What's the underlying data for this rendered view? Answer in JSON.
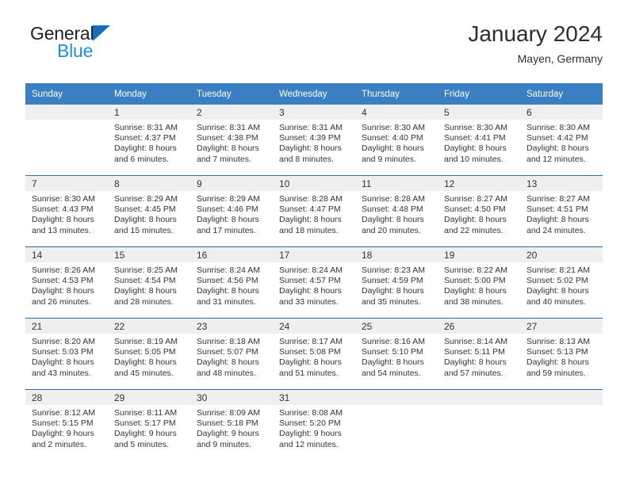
{
  "brand": {
    "name_part1": "General",
    "name_part2": "Blue",
    "triangle_color": "#1470bd",
    "blue_color": "#1b8fe0"
  },
  "header": {
    "title": "January 2024",
    "subtitle": "Mayen, Germany"
  },
  "theme": {
    "header_row_bg": "#3a7fc1",
    "row_divider": "#2a6ead",
    "daynum_band_bg": "#efefef"
  },
  "weekday_headers": [
    "Sunday",
    "Monday",
    "Tuesday",
    "Wednesday",
    "Thursday",
    "Friday",
    "Saturday"
  ],
  "weeks": [
    [
      {
        "day": "",
        "lines": []
      },
      {
        "day": "1",
        "lines": [
          "Sunrise: 8:31 AM",
          "Sunset: 4:37 PM",
          "Daylight: 8 hours",
          "and 6 minutes."
        ]
      },
      {
        "day": "2",
        "lines": [
          "Sunrise: 8:31 AM",
          "Sunset: 4:38 PM",
          "Daylight: 8 hours",
          "and 7 minutes."
        ]
      },
      {
        "day": "3",
        "lines": [
          "Sunrise: 8:31 AM",
          "Sunset: 4:39 PM",
          "Daylight: 8 hours",
          "and 8 minutes."
        ]
      },
      {
        "day": "4",
        "lines": [
          "Sunrise: 8:30 AM",
          "Sunset: 4:40 PM",
          "Daylight: 8 hours",
          "and 9 minutes."
        ]
      },
      {
        "day": "5",
        "lines": [
          "Sunrise: 8:30 AM",
          "Sunset: 4:41 PM",
          "Daylight: 8 hours",
          "and 10 minutes."
        ]
      },
      {
        "day": "6",
        "lines": [
          "Sunrise: 8:30 AM",
          "Sunset: 4:42 PM",
          "Daylight: 8 hours",
          "and 12 minutes."
        ]
      }
    ],
    [
      {
        "day": "7",
        "lines": [
          "Sunrise: 8:30 AM",
          "Sunset: 4:43 PM",
          "Daylight: 8 hours",
          "and 13 minutes."
        ]
      },
      {
        "day": "8",
        "lines": [
          "Sunrise: 8:29 AM",
          "Sunset: 4:45 PM",
          "Daylight: 8 hours",
          "and 15 minutes."
        ]
      },
      {
        "day": "9",
        "lines": [
          "Sunrise: 8:29 AM",
          "Sunset: 4:46 PM",
          "Daylight: 8 hours",
          "and 17 minutes."
        ]
      },
      {
        "day": "10",
        "lines": [
          "Sunrise: 8:28 AM",
          "Sunset: 4:47 PM",
          "Daylight: 8 hours",
          "and 18 minutes."
        ]
      },
      {
        "day": "11",
        "lines": [
          "Sunrise: 8:28 AM",
          "Sunset: 4:48 PM",
          "Daylight: 8 hours",
          "and 20 minutes."
        ]
      },
      {
        "day": "12",
        "lines": [
          "Sunrise: 8:27 AM",
          "Sunset: 4:50 PM",
          "Daylight: 8 hours",
          "and 22 minutes."
        ]
      },
      {
        "day": "13",
        "lines": [
          "Sunrise: 8:27 AM",
          "Sunset: 4:51 PM",
          "Daylight: 8 hours",
          "and 24 minutes."
        ]
      }
    ],
    [
      {
        "day": "14",
        "lines": [
          "Sunrise: 8:26 AM",
          "Sunset: 4:53 PM",
          "Daylight: 8 hours",
          "and 26 minutes."
        ]
      },
      {
        "day": "15",
        "lines": [
          "Sunrise: 8:25 AM",
          "Sunset: 4:54 PM",
          "Daylight: 8 hours",
          "and 28 minutes."
        ]
      },
      {
        "day": "16",
        "lines": [
          "Sunrise: 8:24 AM",
          "Sunset: 4:56 PM",
          "Daylight: 8 hours",
          "and 31 minutes."
        ]
      },
      {
        "day": "17",
        "lines": [
          "Sunrise: 8:24 AM",
          "Sunset: 4:57 PM",
          "Daylight: 8 hours",
          "and 33 minutes."
        ]
      },
      {
        "day": "18",
        "lines": [
          "Sunrise: 8:23 AM",
          "Sunset: 4:59 PM",
          "Daylight: 8 hours",
          "and 35 minutes."
        ]
      },
      {
        "day": "19",
        "lines": [
          "Sunrise: 8:22 AM",
          "Sunset: 5:00 PM",
          "Daylight: 8 hours",
          "and 38 minutes."
        ]
      },
      {
        "day": "20",
        "lines": [
          "Sunrise: 8:21 AM",
          "Sunset: 5:02 PM",
          "Daylight: 8 hours",
          "and 40 minutes."
        ]
      }
    ],
    [
      {
        "day": "21",
        "lines": [
          "Sunrise: 8:20 AM",
          "Sunset: 5:03 PM",
          "Daylight: 8 hours",
          "and 43 minutes."
        ]
      },
      {
        "day": "22",
        "lines": [
          "Sunrise: 8:19 AM",
          "Sunset: 5:05 PM",
          "Daylight: 8 hours",
          "and 45 minutes."
        ]
      },
      {
        "day": "23",
        "lines": [
          "Sunrise: 8:18 AM",
          "Sunset: 5:07 PM",
          "Daylight: 8 hours",
          "and 48 minutes."
        ]
      },
      {
        "day": "24",
        "lines": [
          "Sunrise: 8:17 AM",
          "Sunset: 5:08 PM",
          "Daylight: 8 hours",
          "and 51 minutes."
        ]
      },
      {
        "day": "25",
        "lines": [
          "Sunrise: 8:16 AM",
          "Sunset: 5:10 PM",
          "Daylight: 8 hours",
          "and 54 minutes."
        ]
      },
      {
        "day": "26",
        "lines": [
          "Sunrise: 8:14 AM",
          "Sunset: 5:11 PM",
          "Daylight: 8 hours",
          "and 57 minutes."
        ]
      },
      {
        "day": "27",
        "lines": [
          "Sunrise: 8:13 AM",
          "Sunset: 5:13 PM",
          "Daylight: 8 hours",
          "and 59 minutes."
        ]
      }
    ],
    [
      {
        "day": "28",
        "lines": [
          "Sunrise: 8:12 AM",
          "Sunset: 5:15 PM",
          "Daylight: 9 hours",
          "and 2 minutes."
        ]
      },
      {
        "day": "29",
        "lines": [
          "Sunrise: 8:11 AM",
          "Sunset: 5:17 PM",
          "Daylight: 9 hours",
          "and 5 minutes."
        ]
      },
      {
        "day": "30",
        "lines": [
          "Sunrise: 8:09 AM",
          "Sunset: 5:18 PM",
          "Daylight: 9 hours",
          "and 9 minutes."
        ]
      },
      {
        "day": "31",
        "lines": [
          "Sunrise: 8:08 AM",
          "Sunset: 5:20 PM",
          "Daylight: 9 hours",
          "and 12 minutes."
        ]
      },
      {
        "day": "",
        "lines": []
      },
      {
        "day": "",
        "lines": []
      },
      {
        "day": "",
        "lines": []
      }
    ]
  ]
}
